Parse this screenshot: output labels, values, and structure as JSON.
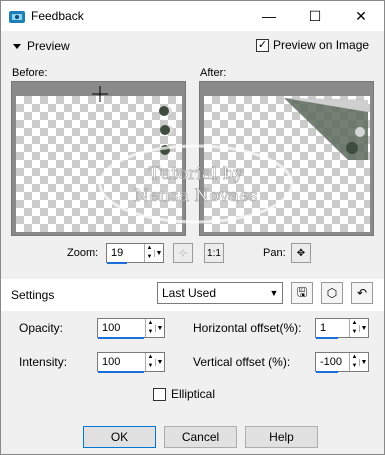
{
  "window": {
    "title": "Feedback",
    "controls": {
      "minimize": "—",
      "maximize": "☐",
      "close": "✕"
    }
  },
  "preview": {
    "toggle_label": "Preview",
    "preview_on_image_label": "Preview on Image",
    "preview_on_image_checked": "✓",
    "before_label": "Before:",
    "after_label": "After:"
  },
  "zoom": {
    "label": "Zoom:",
    "value": "19",
    "pan_label": "Pan:"
  },
  "settings": {
    "label": "Settings",
    "preset_value": "Last Used"
  },
  "params": {
    "opacity_label": "Opacity:",
    "opacity_value": "100",
    "intensity_label": "Intensity:",
    "intensity_value": "100",
    "h_offset_label": "Horizontal offset(%):",
    "h_offset_value": "1",
    "v_offset_label": "Vertical offset (%):",
    "v_offset_value": "-100",
    "elliptical_label": "Elliptical"
  },
  "watermark": {
    "line1": "Tutorial by",
    "line2": "Nensa Novaes"
  },
  "buttons": {
    "ok": "OK",
    "cancel": "Cancel",
    "help": "Help"
  }
}
